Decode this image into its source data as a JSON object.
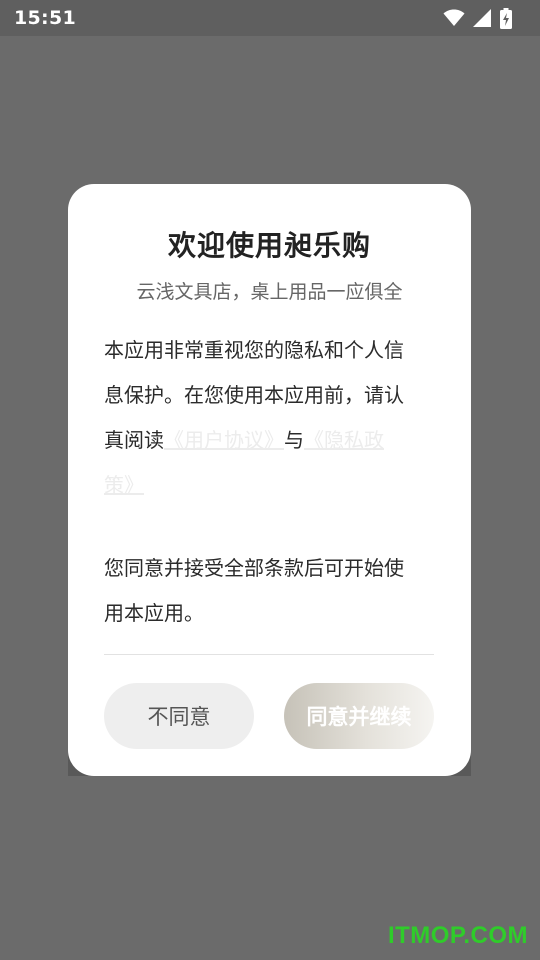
{
  "status_bar": {
    "time": "15:51",
    "icons": [
      "wifi-icon",
      "cellular-signal-icon",
      "battery-charging-icon"
    ]
  },
  "dialog": {
    "title": "欢迎使用昶乐购",
    "subtitle": "云浅文具店，桌上用品一应俱全",
    "body": {
      "para1_line1": "本应用非常重视您的隐私和个人信",
      "para1_line2": "息保护。在您使用本应用前，请认",
      "para1_line3_prefix": "真阅读",
      "user_agreement_link": "《用户协议》",
      "connector": "与",
      "privacy_link_part1": "《隐私政",
      "privacy_link_part2": "策》",
      "para2_line1": "您同意并接受全部条款后可开始使",
      "para2_line2": "用本应用。"
    },
    "buttons": {
      "disagree": "不同意",
      "agree": "同意并继续"
    }
  },
  "watermark": "ITMOP.COM",
  "colors": {
    "overlay": "#6b6b6b",
    "status_bar": "#5f5f5f",
    "dialog_bg": "#ffffff",
    "link": "#ececec",
    "watermark": "#2fcc2a"
  }
}
